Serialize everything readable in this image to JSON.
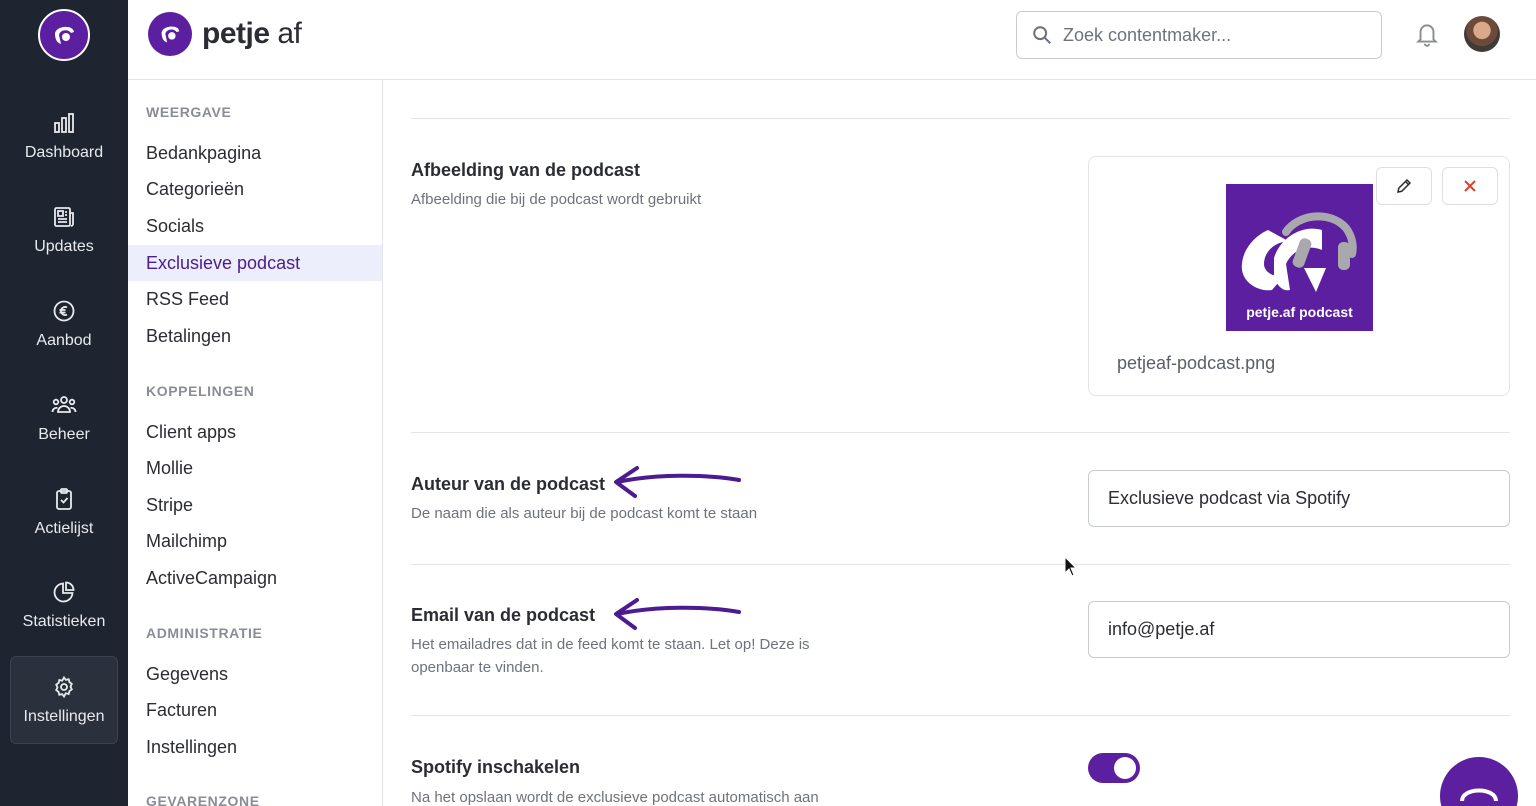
{
  "brand": {
    "name_bold": "petje",
    "name_light": " af"
  },
  "rail": [
    {
      "label": "Dashboard",
      "icon": "bar-chart-icon"
    },
    {
      "label": "Updates",
      "icon": "newspaper-icon"
    },
    {
      "label": "Aanbod",
      "icon": "euro-icon"
    },
    {
      "label": "Beheer",
      "icon": "users-icon"
    },
    {
      "label": "Actielijst",
      "icon": "clipboard-check-icon"
    },
    {
      "label": "Statistieken",
      "icon": "pie-chart-icon"
    },
    {
      "label": "Instellingen",
      "icon": "gear-icon",
      "active": true
    }
  ],
  "search": {
    "placeholder": "Zoek contentmaker..."
  },
  "submenu": {
    "weergave": {
      "title": "WEERGAVE",
      "items": [
        "Bedankpagina",
        "Categorieën",
        "Socials",
        "Exclusieve podcast",
        "RSS Feed",
        "Betalingen"
      ]
    },
    "koppelingen": {
      "title": "KOPPELINGEN",
      "items": [
        "Client apps",
        "Mollie",
        "Stripe",
        "Mailchimp",
        "ActiveCampaign"
      ]
    },
    "administratie": {
      "title": "ADMINISTRATIE",
      "items": [
        "Gegevens",
        "Facturen",
        "Instellingen"
      ]
    },
    "gevarenzone": {
      "title": "GEVARENZONE"
    }
  },
  "settings": {
    "image": {
      "label": "Afbeelding van de podcast",
      "desc": "Afbeelding die bij de podcast wordt gebruikt",
      "tile_text": "petje.af podcast",
      "filename": "petjeaf-podcast.png"
    },
    "author": {
      "label": "Auteur van de podcast",
      "desc": "De naam die als auteur bij de podcast komt te staan",
      "value": "Exclusieve podcast via Spotify"
    },
    "email": {
      "label": "Email van de podcast",
      "desc_line1": "Het emailadres dat in de feed komt te staan. Let op! Deze is",
      "desc_line2": "openbaar te vinden.",
      "value": "info@petje.af"
    },
    "spotify": {
      "label": "Spotify inschakelen",
      "desc": "Na het opslaan wordt de exclusieve podcast automatisch aan",
      "enabled": true
    }
  },
  "colors": {
    "accent": "#5b1fa0",
    "rail_bg": "#1e2430",
    "active_bg": "#eceefb",
    "delete": "#d9432f"
  }
}
